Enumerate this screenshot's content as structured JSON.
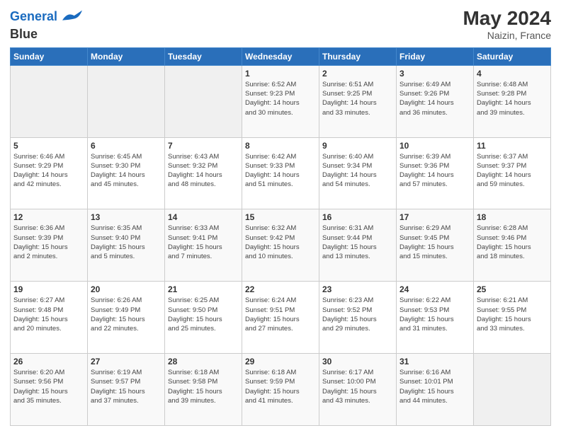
{
  "header": {
    "logo_line1": "General",
    "logo_line2": "Blue",
    "month_year": "May 2024",
    "location": "Naizin, France"
  },
  "weekdays": [
    "Sunday",
    "Monday",
    "Tuesday",
    "Wednesday",
    "Thursday",
    "Friday",
    "Saturday"
  ],
  "weeks": [
    [
      {
        "day": "",
        "info": ""
      },
      {
        "day": "",
        "info": ""
      },
      {
        "day": "",
        "info": ""
      },
      {
        "day": "1",
        "info": "Sunrise: 6:52 AM\nSunset: 9:23 PM\nDaylight: 14 hours\nand 30 minutes."
      },
      {
        "day": "2",
        "info": "Sunrise: 6:51 AM\nSunset: 9:25 PM\nDaylight: 14 hours\nand 33 minutes."
      },
      {
        "day": "3",
        "info": "Sunrise: 6:49 AM\nSunset: 9:26 PM\nDaylight: 14 hours\nand 36 minutes."
      },
      {
        "day": "4",
        "info": "Sunrise: 6:48 AM\nSunset: 9:28 PM\nDaylight: 14 hours\nand 39 minutes."
      }
    ],
    [
      {
        "day": "5",
        "info": "Sunrise: 6:46 AM\nSunset: 9:29 PM\nDaylight: 14 hours\nand 42 minutes."
      },
      {
        "day": "6",
        "info": "Sunrise: 6:45 AM\nSunset: 9:30 PM\nDaylight: 14 hours\nand 45 minutes."
      },
      {
        "day": "7",
        "info": "Sunrise: 6:43 AM\nSunset: 9:32 PM\nDaylight: 14 hours\nand 48 minutes."
      },
      {
        "day": "8",
        "info": "Sunrise: 6:42 AM\nSunset: 9:33 PM\nDaylight: 14 hours\nand 51 minutes."
      },
      {
        "day": "9",
        "info": "Sunrise: 6:40 AM\nSunset: 9:34 PM\nDaylight: 14 hours\nand 54 minutes."
      },
      {
        "day": "10",
        "info": "Sunrise: 6:39 AM\nSunset: 9:36 PM\nDaylight: 14 hours\nand 57 minutes."
      },
      {
        "day": "11",
        "info": "Sunrise: 6:37 AM\nSunset: 9:37 PM\nDaylight: 14 hours\nand 59 minutes."
      }
    ],
    [
      {
        "day": "12",
        "info": "Sunrise: 6:36 AM\nSunset: 9:39 PM\nDaylight: 15 hours\nand 2 minutes."
      },
      {
        "day": "13",
        "info": "Sunrise: 6:35 AM\nSunset: 9:40 PM\nDaylight: 15 hours\nand 5 minutes."
      },
      {
        "day": "14",
        "info": "Sunrise: 6:33 AM\nSunset: 9:41 PM\nDaylight: 15 hours\nand 7 minutes."
      },
      {
        "day": "15",
        "info": "Sunrise: 6:32 AM\nSunset: 9:42 PM\nDaylight: 15 hours\nand 10 minutes."
      },
      {
        "day": "16",
        "info": "Sunrise: 6:31 AM\nSunset: 9:44 PM\nDaylight: 15 hours\nand 13 minutes."
      },
      {
        "day": "17",
        "info": "Sunrise: 6:29 AM\nSunset: 9:45 PM\nDaylight: 15 hours\nand 15 minutes."
      },
      {
        "day": "18",
        "info": "Sunrise: 6:28 AM\nSunset: 9:46 PM\nDaylight: 15 hours\nand 18 minutes."
      }
    ],
    [
      {
        "day": "19",
        "info": "Sunrise: 6:27 AM\nSunset: 9:48 PM\nDaylight: 15 hours\nand 20 minutes."
      },
      {
        "day": "20",
        "info": "Sunrise: 6:26 AM\nSunset: 9:49 PM\nDaylight: 15 hours\nand 22 minutes."
      },
      {
        "day": "21",
        "info": "Sunrise: 6:25 AM\nSunset: 9:50 PM\nDaylight: 15 hours\nand 25 minutes."
      },
      {
        "day": "22",
        "info": "Sunrise: 6:24 AM\nSunset: 9:51 PM\nDaylight: 15 hours\nand 27 minutes."
      },
      {
        "day": "23",
        "info": "Sunrise: 6:23 AM\nSunset: 9:52 PM\nDaylight: 15 hours\nand 29 minutes."
      },
      {
        "day": "24",
        "info": "Sunrise: 6:22 AM\nSunset: 9:53 PM\nDaylight: 15 hours\nand 31 minutes."
      },
      {
        "day": "25",
        "info": "Sunrise: 6:21 AM\nSunset: 9:55 PM\nDaylight: 15 hours\nand 33 minutes."
      }
    ],
    [
      {
        "day": "26",
        "info": "Sunrise: 6:20 AM\nSunset: 9:56 PM\nDaylight: 15 hours\nand 35 minutes."
      },
      {
        "day": "27",
        "info": "Sunrise: 6:19 AM\nSunset: 9:57 PM\nDaylight: 15 hours\nand 37 minutes."
      },
      {
        "day": "28",
        "info": "Sunrise: 6:18 AM\nSunset: 9:58 PM\nDaylight: 15 hours\nand 39 minutes."
      },
      {
        "day": "29",
        "info": "Sunrise: 6:18 AM\nSunset: 9:59 PM\nDaylight: 15 hours\nand 41 minutes."
      },
      {
        "day": "30",
        "info": "Sunrise: 6:17 AM\nSunset: 10:00 PM\nDaylight: 15 hours\nand 43 minutes."
      },
      {
        "day": "31",
        "info": "Sunrise: 6:16 AM\nSunset: 10:01 PM\nDaylight: 15 hours\nand 44 minutes."
      },
      {
        "day": "",
        "info": ""
      }
    ]
  ]
}
